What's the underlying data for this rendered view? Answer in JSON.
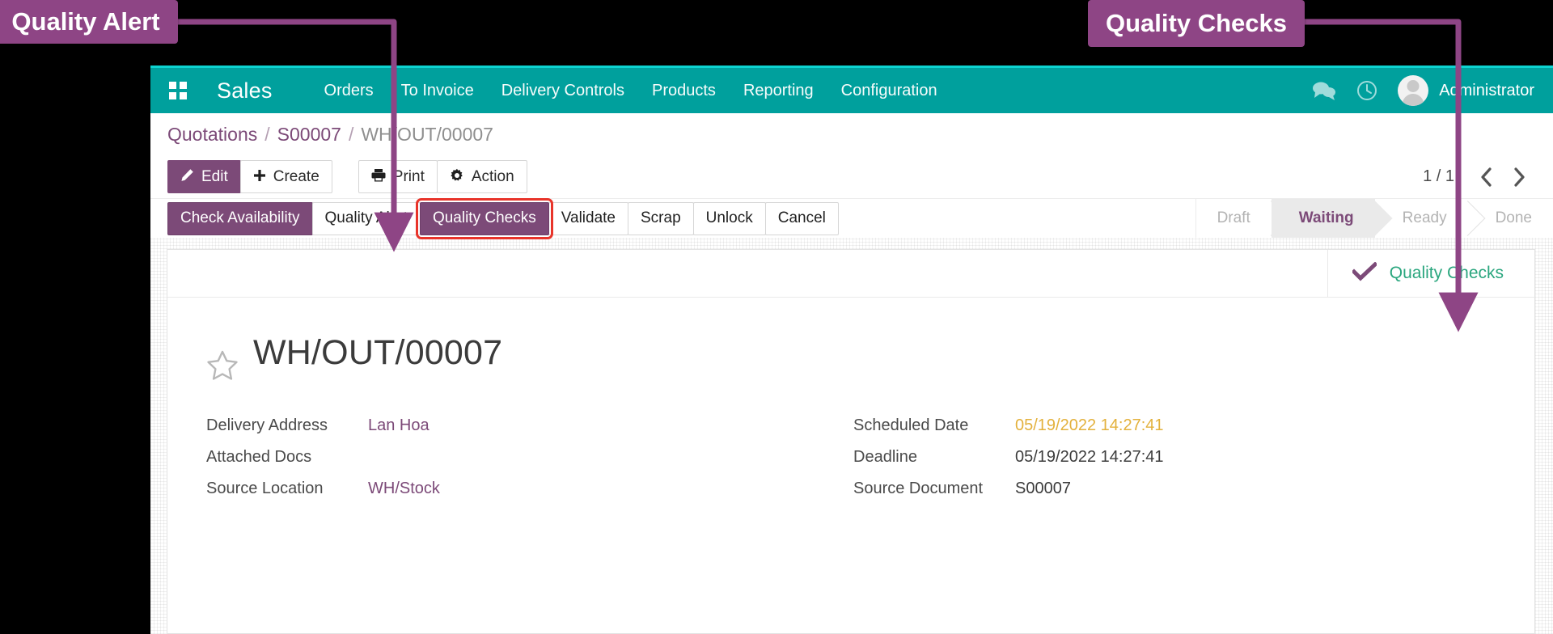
{
  "annotations": [
    {
      "id": "quality-alert-callout",
      "label": "Quality Alert",
      "color": "#8E4585"
    },
    {
      "id": "quality-checks-callout",
      "label": "Quality Checks",
      "color": "#8E4585"
    }
  ],
  "navbar": {
    "apps_icon": "apps-grid-icon",
    "brand": "Sales",
    "menu": [
      {
        "label": "Orders"
      },
      {
        "label": "To Invoice"
      },
      {
        "label": "Delivery Controls"
      },
      {
        "label": "Products"
      },
      {
        "label": "Reporting"
      },
      {
        "label": "Configuration"
      }
    ],
    "messages_icon": "chat-bubbles-icon",
    "activities_icon": "clock-icon",
    "avatar_icon": "user-avatar-icon",
    "user": "Administrator"
  },
  "breadcrumb": {
    "root": "Quotations",
    "sep": "/",
    "parent": "S00007",
    "current": "WH/OUT/00007"
  },
  "controlbar": {
    "edit": "Edit",
    "edit_icon": "pencil-icon",
    "create": "Create",
    "create_icon": "plus-icon",
    "print": "Print",
    "print_icon": "printer-icon",
    "action": "Action",
    "action_icon": "gear-icon",
    "pager_count": "1 / 1",
    "prev_icon": "chevron-left-icon",
    "next_icon": "chevron-right-icon"
  },
  "statusbar": {
    "buttons": [
      {
        "label": "Check Availability",
        "style": "primary",
        "highlighted": false
      },
      {
        "label": "Quality Alert",
        "style": "default",
        "highlighted": false
      },
      {
        "label": "Quality Checks",
        "style": "primary",
        "highlighted": true
      },
      {
        "label": "Validate",
        "style": "default",
        "highlighted": false
      },
      {
        "label": "Scrap",
        "style": "default",
        "highlighted": false
      },
      {
        "label": "Unlock",
        "style": "default",
        "highlighted": false
      },
      {
        "label": "Cancel",
        "style": "default",
        "highlighted": false
      }
    ],
    "stages": [
      {
        "label": "Draft",
        "active": false
      },
      {
        "label": "Waiting",
        "active": true
      },
      {
        "label": "Ready",
        "active": false
      },
      {
        "label": "Done",
        "active": false
      }
    ]
  },
  "sheet": {
    "smart_button": {
      "icon": "check-mark-icon",
      "label": "Quality Checks"
    },
    "favorite_icon": "star-outline-icon",
    "title": "WH/OUT/00007",
    "left_fields": [
      {
        "label": "Delivery Address",
        "value": "Lan Hoa",
        "style": "link"
      },
      {
        "label": "Attached Docs",
        "value": "",
        "style": "link"
      },
      {
        "label": "Source Location",
        "value": "WH/Stock",
        "style": "link"
      }
    ],
    "right_fields": [
      {
        "label": "Scheduled Date",
        "value": "05/19/2022 14:27:41",
        "style": "warn"
      },
      {
        "label": "Deadline",
        "value": "05/19/2022 14:27:41",
        "style": "plain"
      },
      {
        "label": "Source Document",
        "value": "S00007",
        "style": "plain"
      }
    ]
  },
  "colors": {
    "navbar_teal": "#00A09D",
    "accent_purple": "#7C4A78",
    "callout_purple": "#8E4585",
    "highlight_red": "#e8342a",
    "smart_green": "#2aa67e",
    "warn_gold": "#e3b13c"
  }
}
